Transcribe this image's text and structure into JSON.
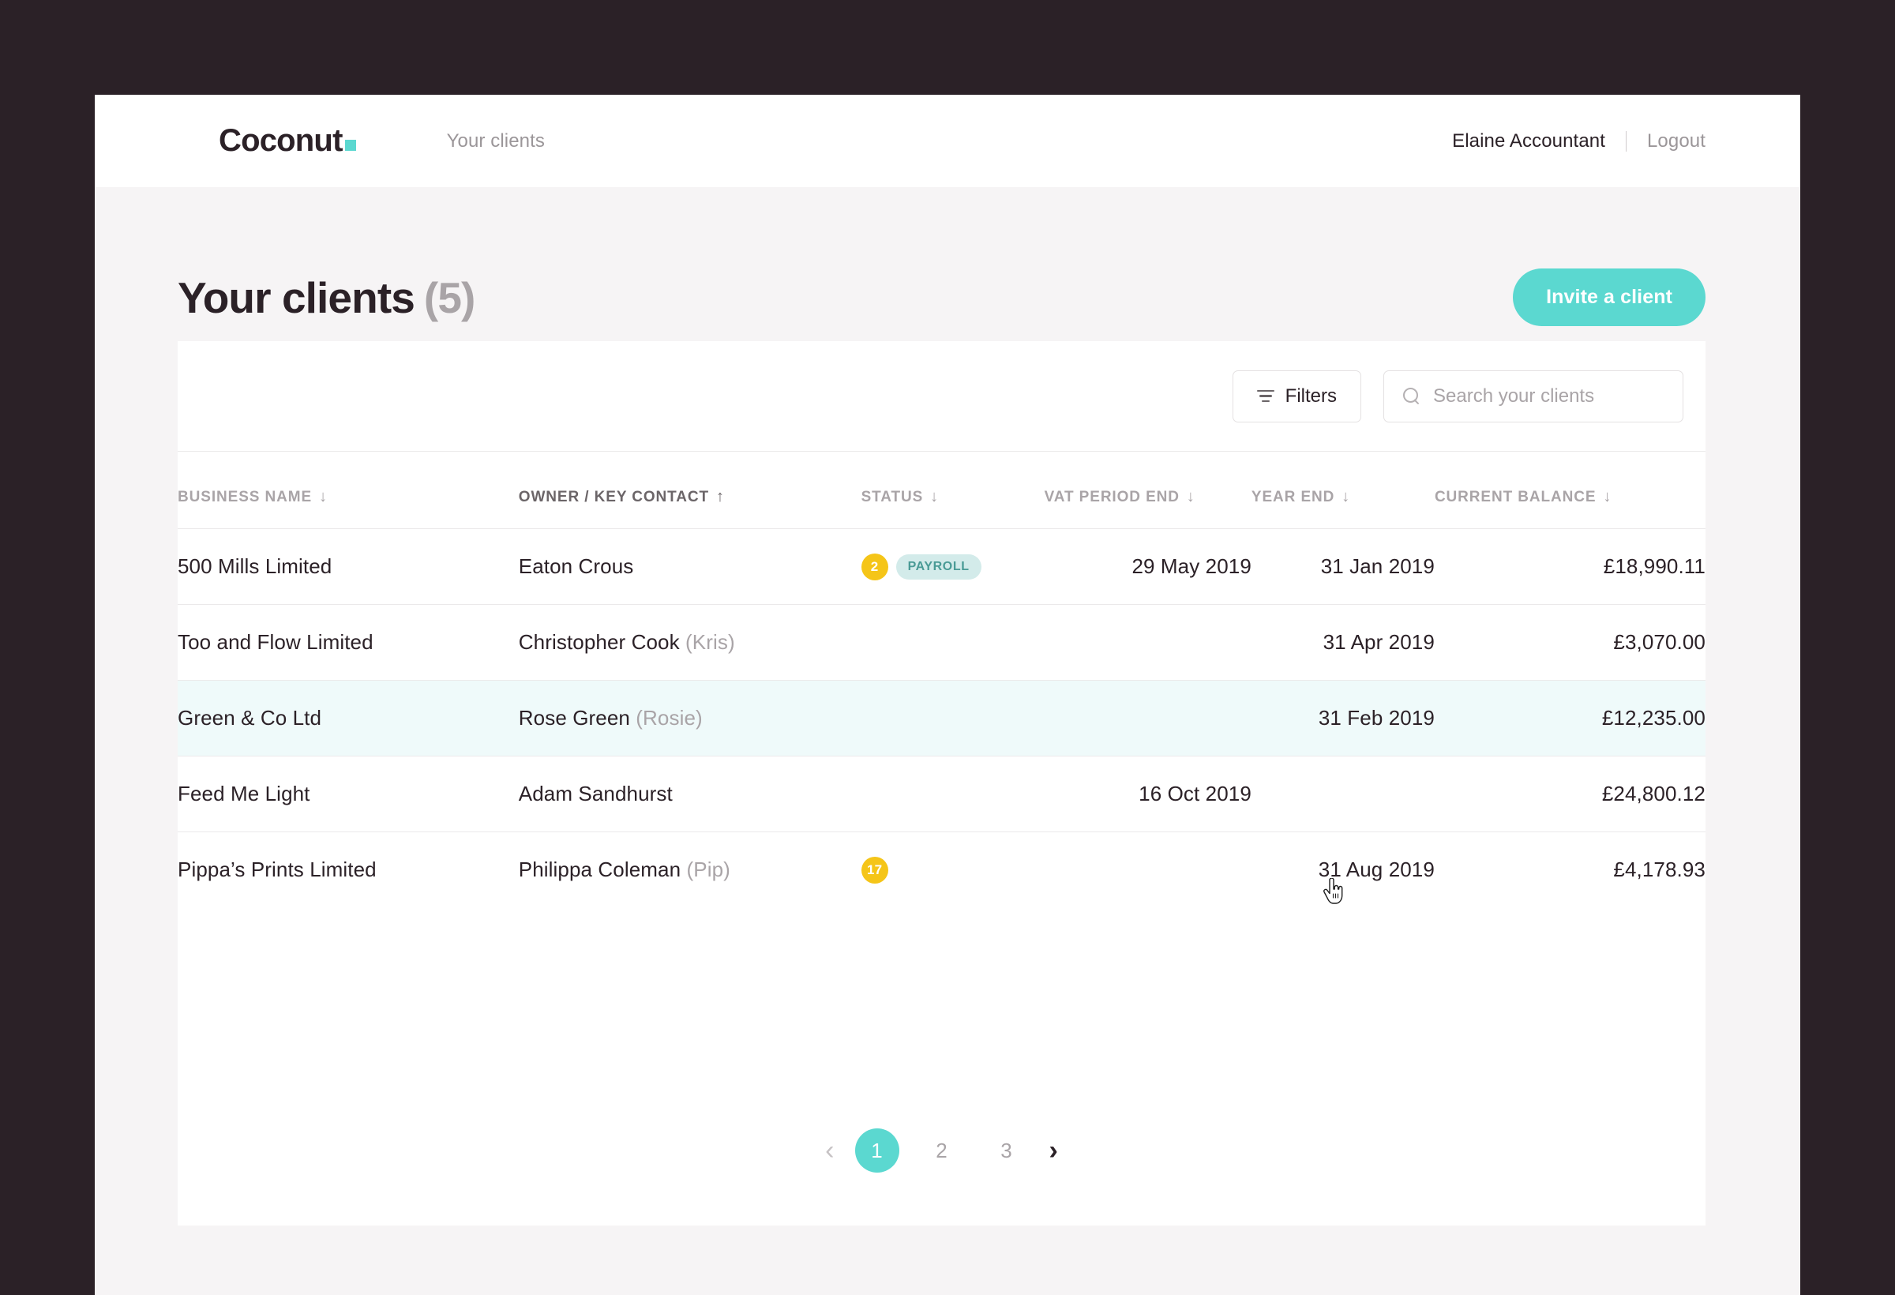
{
  "topbar": {
    "brand": "Coconut",
    "nav": [
      {
        "label": "Your clients"
      }
    ],
    "user_name": "Elaine Accountant",
    "logout_label": "Logout"
  },
  "page": {
    "title": "Your clients",
    "count": "(5)",
    "invite_button": "Invite a client"
  },
  "toolbar": {
    "filters_label": "Filters",
    "search_placeholder": "Search your clients",
    "search_value": ""
  },
  "table": {
    "columns": [
      {
        "label": "Business name",
        "sort": "↓",
        "active": false
      },
      {
        "label": "Owner / Key contact",
        "sort": "↑",
        "active": true
      },
      {
        "label": "Status",
        "sort": "↓",
        "active": false
      },
      {
        "label": "VAT period end",
        "sort": "↓",
        "active": false
      },
      {
        "label": "Year end",
        "sort": "↓",
        "active": false
      },
      {
        "label": "Current balance",
        "sort": "↓",
        "active": false
      }
    ],
    "rows": [
      {
        "business_name": "500 Mills Limited",
        "owner": "Eaton Crous",
        "owner_alias": "",
        "status_count": "2",
        "status_tag": "PAYROLL",
        "vat_period_end": "29 May 2019",
        "year_end": "31 Jan 2019",
        "current_balance": "£18,990.11",
        "highlighted": false
      },
      {
        "business_name": "Too and Flow Limited",
        "owner": "Christopher Cook",
        "owner_alias": "(Kris)",
        "status_count": "",
        "status_tag": "",
        "vat_period_end": "",
        "year_end": "31 Apr 2019",
        "current_balance": "£3,070.00",
        "highlighted": false
      },
      {
        "business_name": "Green & Co Ltd",
        "owner": "Rose Green",
        "owner_alias": "(Rosie)",
        "status_count": "",
        "status_tag": "",
        "vat_period_end": "",
        "year_end": "31 Feb 2019",
        "current_balance": "£12,235.00",
        "highlighted": true
      },
      {
        "business_name": "Feed Me Light",
        "owner": "Adam Sandhurst",
        "owner_alias": "",
        "status_count": "",
        "status_tag": "",
        "vat_period_end": "16 Oct 2019",
        "year_end": "",
        "current_balance": "£24,800.12",
        "highlighted": false
      },
      {
        "business_name": "Pippa’s Prints Limited",
        "owner": "Philippa Coleman",
        "owner_alias": "(Pip)",
        "status_count": "17",
        "status_tag": "",
        "vat_period_end": "",
        "year_end": "31 Aug 2019",
        "current_balance": "£4,178.93",
        "highlighted": false
      }
    ]
  },
  "pagination": {
    "prev": "‹",
    "next": "›",
    "pages": [
      "1",
      "2",
      "3"
    ],
    "current": "1"
  },
  "colors": {
    "accent": "#5bd8d0",
    "badge_yellow": "#f5c518",
    "tag_bg": "#d3ebea",
    "tag_text": "#4a9b96",
    "row_highlight": "#effafa",
    "backdrop": "#2b2127",
    "page_bg": "#f6f4f5"
  }
}
